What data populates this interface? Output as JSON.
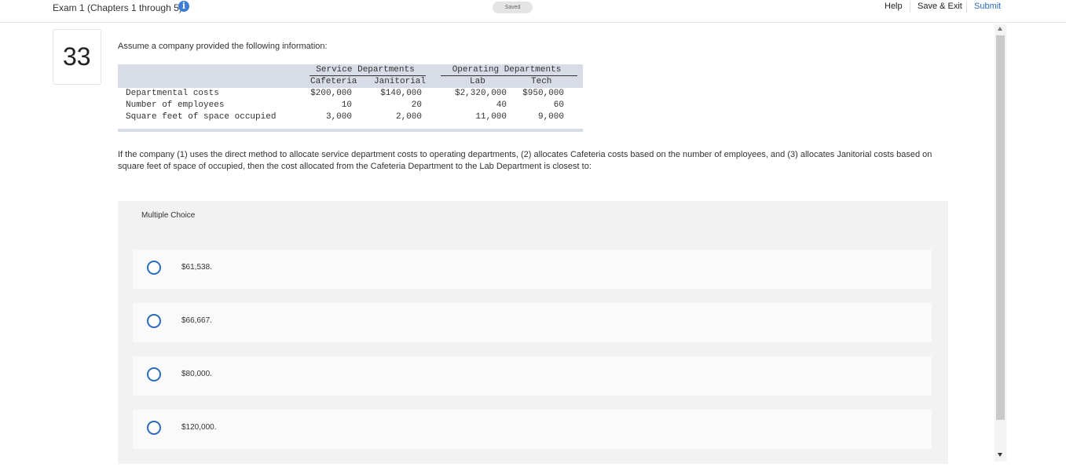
{
  "header": {
    "exam_title": "Exam 1 (Chapters 1 through 5)",
    "info_icon": "i",
    "saved": "Saved",
    "help": "Help",
    "save_exit": "Save & Exit",
    "submit": "Submit"
  },
  "question": {
    "number": "33",
    "prompt": "Assume a company provided the following information:",
    "text": "If the company (1) uses the direct method to allocate service department costs to operating departments, (2) allocates Cafeteria costs based on the number of employees, and (3) allocates Janitorial costs based on square feet of space of occupied, then the cost allocated from the Cafeteria Department to the Lab Department is closest to:"
  },
  "table": {
    "group_service": "Service Departments",
    "group_operating": "Operating Departments",
    "columns": [
      "Cafeteria",
      "Janitorial",
      "Lab",
      "Tech"
    ],
    "rows": [
      {
        "label": "Departmental costs",
        "values": [
          "$200,000",
          "$140,000",
          "$2,320,000",
          "$950,000"
        ]
      },
      {
        "label": "Number of employees",
        "values": [
          "10",
          "20",
          "40",
          "60"
        ]
      },
      {
        "label": "Square feet of space occupied",
        "values": [
          "3,000",
          "2,000",
          "11,000",
          "9,000"
        ]
      }
    ]
  },
  "choices": {
    "header": "Multiple Choice",
    "options": [
      "$61,538.",
      "$66,667.",
      "$80,000.",
      "$120,000."
    ]
  }
}
